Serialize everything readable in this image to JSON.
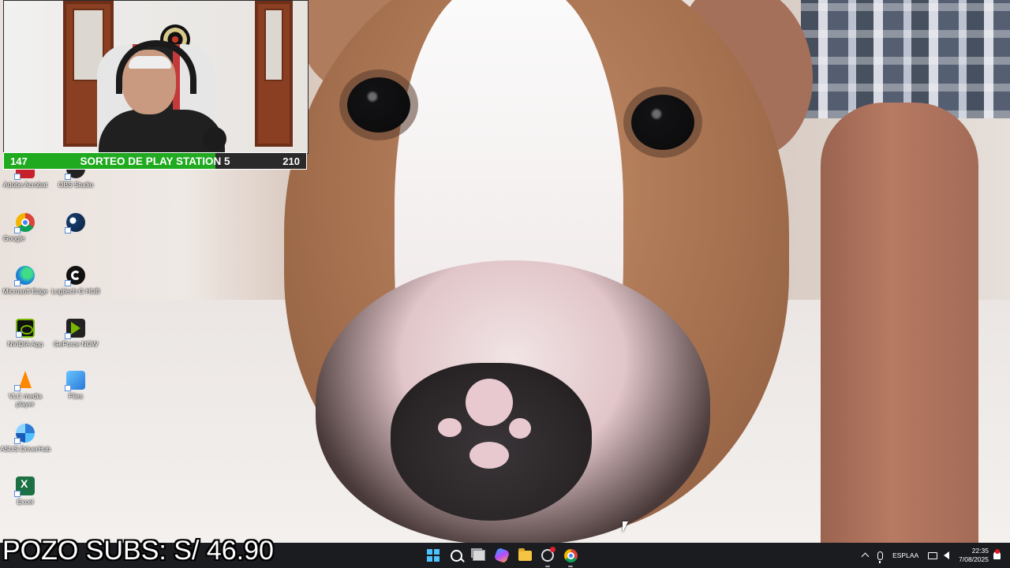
{
  "overlay": {
    "sub_counter": {
      "current": "147",
      "title": "SORTEO DE PLAY STATION 5",
      "goal": "210",
      "progress_fraction": 0.7
    },
    "pozo_text": "POZO SUBS: S/ 46.90"
  },
  "desktop": {
    "icons": [
      {
        "label": "Adobe Acrobat",
        "icon": "acrobat-icon"
      },
      {
        "label": "OBS Studio",
        "icon": "obs-icon"
      },
      {
        "label": "Google",
        "icon": "chrome-icon"
      },
      {
        "label": "",
        "icon": "steam-icon"
      },
      {
        "label": "Microsoft Edge",
        "icon": "edge-icon"
      },
      {
        "label": "Logitech G HUB",
        "icon": "logitech-ghub-icon"
      },
      {
        "label": "NVIDIA App",
        "icon": "nvidia-icon"
      },
      {
        "label": "GeForce NOW",
        "icon": "geforce-now-icon"
      },
      {
        "label": "VLC media player",
        "icon": "vlc-icon"
      },
      {
        "label": "Files",
        "icon": "files-icon"
      },
      {
        "label": "ASUS DriverHub",
        "icon": "asus-driverhub-icon"
      },
      {
        "label": "Excel",
        "icon": "excel-icon"
      }
    ]
  },
  "taskbar": {
    "apps": [
      "start-icon",
      "search-icon",
      "task-view-icon",
      "copilot-icon",
      "file-explorer-icon",
      "app-ring-icon",
      "chrome-icon"
    ],
    "tray": {
      "lang_top": "ESP",
      "lang_bottom": "LAA",
      "time": "22:35",
      "date": "7/08/2025"
    }
  },
  "colors": {
    "counter_fill": "#1faa1f",
    "taskbar_bg": "#1b1c20",
    "windows_accent": "#4cc2ff"
  }
}
